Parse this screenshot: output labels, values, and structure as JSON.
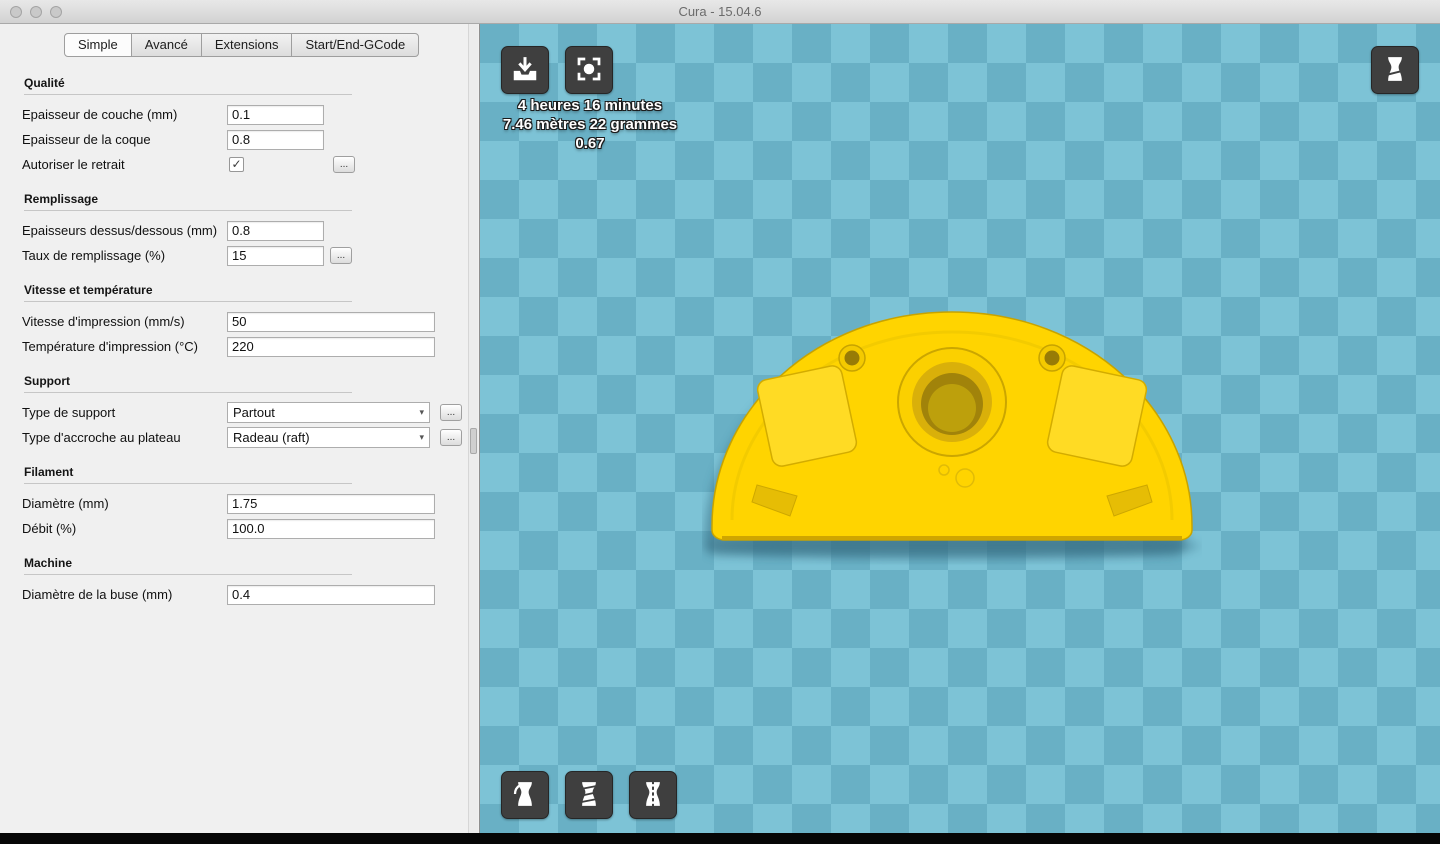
{
  "window": {
    "title": "Cura - 15.04.6",
    "traffic_lights": [
      "close",
      "minimize",
      "zoom"
    ]
  },
  "panel": {
    "more_button_label": "...",
    "tabs": [
      {
        "label": "Simple",
        "active": true
      },
      {
        "label": "Avancé",
        "active": false
      },
      {
        "label": "Extensions",
        "active": false
      },
      {
        "label": "Start/End-GCode",
        "active": false
      }
    ],
    "sections": [
      {
        "title": "Qualité",
        "rows": [
          {
            "label": "Epaisseur de couche (mm)",
            "type": "text-small",
            "value": "0.1"
          },
          {
            "label": "Epaisseur de la coque",
            "type": "text-small",
            "value": "0.8"
          },
          {
            "label": "Autoriser le retrait",
            "type": "checkbox",
            "checked": true,
            "more": true
          }
        ]
      },
      {
        "title": "Remplissage",
        "rows": [
          {
            "label": "Epaisseurs dessus/dessous (mm)",
            "type": "text-small",
            "value": "0.8"
          },
          {
            "label": "Taux de remplissage (%)",
            "type": "text-small",
            "value": "15",
            "more": true
          }
        ]
      },
      {
        "title": "Vitesse et température",
        "rows": [
          {
            "label": "Vitesse d'impression (mm/s)",
            "type": "text-wide",
            "value": "50"
          },
          {
            "label": "Température d'impression (°C)",
            "type": "text-wide",
            "value": "220"
          }
        ]
      },
      {
        "title": "Support",
        "rows": [
          {
            "label": "Type de support",
            "type": "select",
            "value": "Partout",
            "more": true
          },
          {
            "label": "Type d'accroche au plateau",
            "type": "select",
            "value": "Radeau (raft)",
            "more": true
          }
        ]
      },
      {
        "title": "Filament",
        "rows": [
          {
            "label": "Diamètre (mm)",
            "type": "text-wide",
            "value": "1.75"
          },
          {
            "label": "Débit (%)",
            "type": "text-wide",
            "value": "100.0"
          }
        ]
      },
      {
        "title": "Machine",
        "rows": [
          {
            "label": "Diamètre de la buse (mm)",
            "type": "text-wide",
            "value": "0.4"
          }
        ]
      }
    ]
  },
  "viewport": {
    "toolbar_top": [
      {
        "icon": "load-model-icon"
      },
      {
        "icon": "save-toolpath-icon"
      }
    ],
    "toolbar_view": [
      {
        "icon": "view-mode-icon"
      }
    ],
    "toolbar_bottom": [
      {
        "icon": "rotate-model-icon"
      },
      {
        "icon": "scale-model-icon"
      },
      {
        "icon": "mirror-model-icon"
      }
    ],
    "stats": {
      "line1": "4 heures 16 minutes",
      "line2": "7.46 mètres 22 grammes",
      "line3": "0.67"
    },
    "model_description": "yellow half-round cover plate on build platform",
    "colors": {
      "checker_light": "#7dc3d6",
      "checker_dark": "#69b0c5",
      "model_yellow": "#ffd400",
      "model_edge": "#c7a300"
    }
  }
}
